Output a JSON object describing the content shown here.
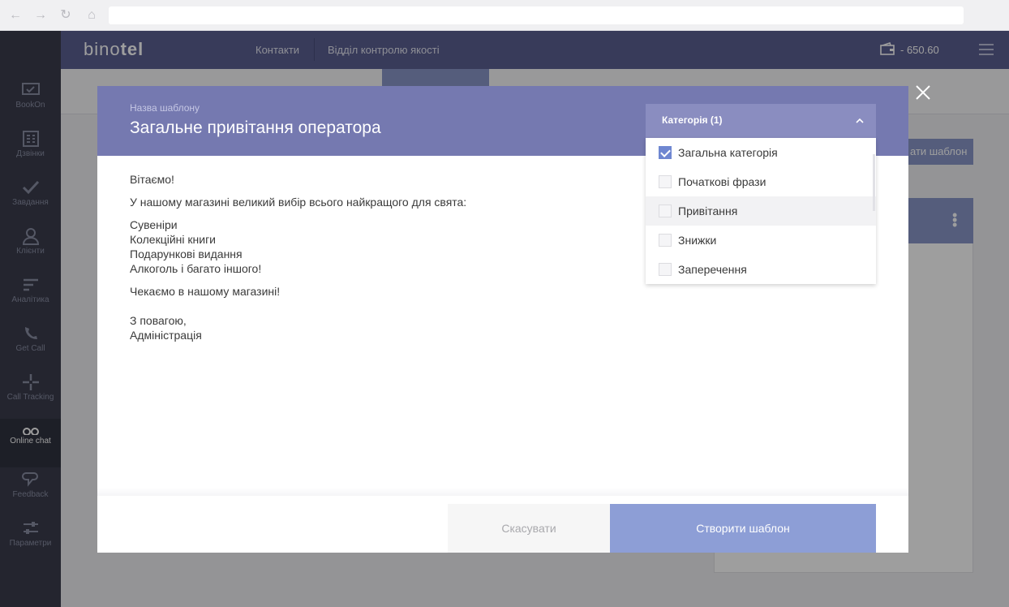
{
  "browser": {
    "icons": [
      "back-arrow-icon",
      "forward-arrow-icon",
      "reload-icon",
      "home-icon"
    ],
    "address": ""
  },
  "sidebar": {
    "items": [
      {
        "label": "BookOn",
        "icon": "bookon-icon",
        "active": false
      },
      {
        "label": "Дзвінки",
        "icon": "calls-icon",
        "active": false
      },
      {
        "label": "Завдання",
        "icon": "tasks-icon",
        "active": false
      },
      {
        "label": "Клієнти",
        "icon": "clients-icon",
        "active": false
      },
      {
        "label": "Аналітика",
        "icon": "analytics-icon",
        "active": false
      },
      {
        "label": "Get Call",
        "icon": "getcall-icon",
        "active": false
      },
      {
        "label": "Call Tracking",
        "icon": "calltracking-icon",
        "active": false
      },
      {
        "label": "Online chat",
        "icon": "online-chat-icon",
        "active": true
      },
      {
        "label": "Feedback",
        "icon": "feedback-icon",
        "active": false
      },
      {
        "label": "Параметри",
        "icon": "settings-icon",
        "active": false
      }
    ]
  },
  "header": {
    "logo_light": "bino",
    "logo_bold": "tel",
    "nav": [
      "Контакти",
      "Відділ контролю якості"
    ],
    "balance": "- 650.60"
  },
  "background": {
    "button_label": "ати шаблон"
  },
  "modal": {
    "name_label": "Назва шаблону",
    "name": "Загальне привітання оператора",
    "body": [
      "Вітаємо!",
      "У нашому магазині великий вибір всього найкращого для свята:",
      "Сувеніри",
      "Колекційні книги",
      "Подарункові видання",
      "Алкоголь і багато іншого!",
      "Чекаємо в нашому магазині!",
      "З повагою,",
      "Адміністрація"
    ],
    "cancel_label": "Скасувати",
    "create_label": "Створити шаблон"
  },
  "category_dropdown": {
    "title": "Категорія (1)",
    "items": [
      {
        "label": "Загальна категорія",
        "checked": true
      },
      {
        "label": "Початкові фрази",
        "checked": false
      },
      {
        "label": "Привітання",
        "checked": false
      },
      {
        "label": "Знижки",
        "checked": false
      },
      {
        "label": "Заперечення",
        "checked": false
      }
    ]
  },
  "colors": {
    "header": "#5b5f92",
    "modal_header": "#7579b0",
    "accent": "#8d9ed6",
    "checkbox": "#6f87d1"
  }
}
